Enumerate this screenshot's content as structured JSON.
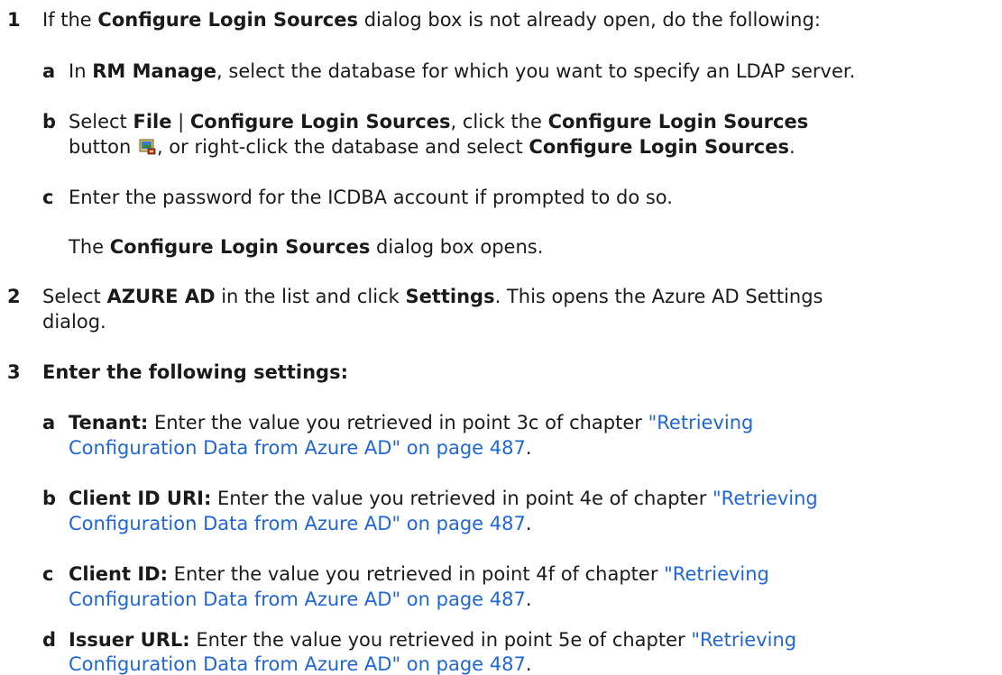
{
  "step1": {
    "number": "1",
    "intro": {
      "t1": "If the ",
      "b1": "Configure Login Sources",
      "t2": " dialog box is not already open, do the following:"
    },
    "a": {
      "letter": "a",
      "t1": "In ",
      "b1": "RM Manage",
      "t2": ", select the database for which you want to specify an LDAP server."
    },
    "b": {
      "letter": "b",
      "line1": {
        "t1": "Select ",
        "b1": "File",
        "t2": " | ",
        "b2": "Configure Login Sources",
        "t3": ", click the ",
        "b3": "Configure Login Sources"
      },
      "line2": {
        "t1": "button ",
        "t2": ", or right-click the database and select ",
        "b1": "Configure Login Sources",
        "t3": "."
      },
      "icon": "configure-login-sources-icon"
    },
    "c": {
      "letter": "c",
      "text": "Enter the password for the ICDBA account if prompted to do so."
    },
    "result": {
      "t1": "The ",
      "b1": "Configure Login Sources",
      "t2": " dialog box opens."
    }
  },
  "step2": {
    "number": "2",
    "line1": {
      "t1": "Select ",
      "b1": "AZURE AD",
      "t2": " in the list and click ",
      "b2": "Settings",
      "t3": ". This opens the Azure AD Settings"
    },
    "line2": "dialog."
  },
  "step3": {
    "number": "3",
    "heading": "Enter the following settings:",
    "items": [
      {
        "letter": "a",
        "label": "Tenant:",
        "text": " Enter the value you retrieved in point 3c of chapter ",
        "link1": "\"Retrieving",
        "link2": "Configuration Data from Azure AD\" on page 487",
        "end": "."
      },
      {
        "letter": "b",
        "label": "Client ID URI:",
        "text": " Enter the value you retrieved in point 4e of chapter ",
        "link1": "\"Retrieving",
        "link2": "Configuration Data from Azure AD\" on page 487",
        "end": "."
      },
      {
        "letter": "c",
        "label": "Client ID:",
        "text": " Enter the value you retrieved in point 4f of chapter ",
        "link1": "\"Retrieving",
        "link2": "Configuration Data from Azure AD\" on page 487",
        "end": "."
      },
      {
        "letter": "d",
        "label": "Issuer URL:",
        "text": " Enter the value you retrieved in point 5e of chapter ",
        "link1": "\"Retrieving",
        "link2": "Configuration Data from Azure AD\" on page 487",
        "end": "."
      }
    ]
  },
  "colors": {
    "link": "#1f66d8",
    "text": "#1a1a1a"
  }
}
